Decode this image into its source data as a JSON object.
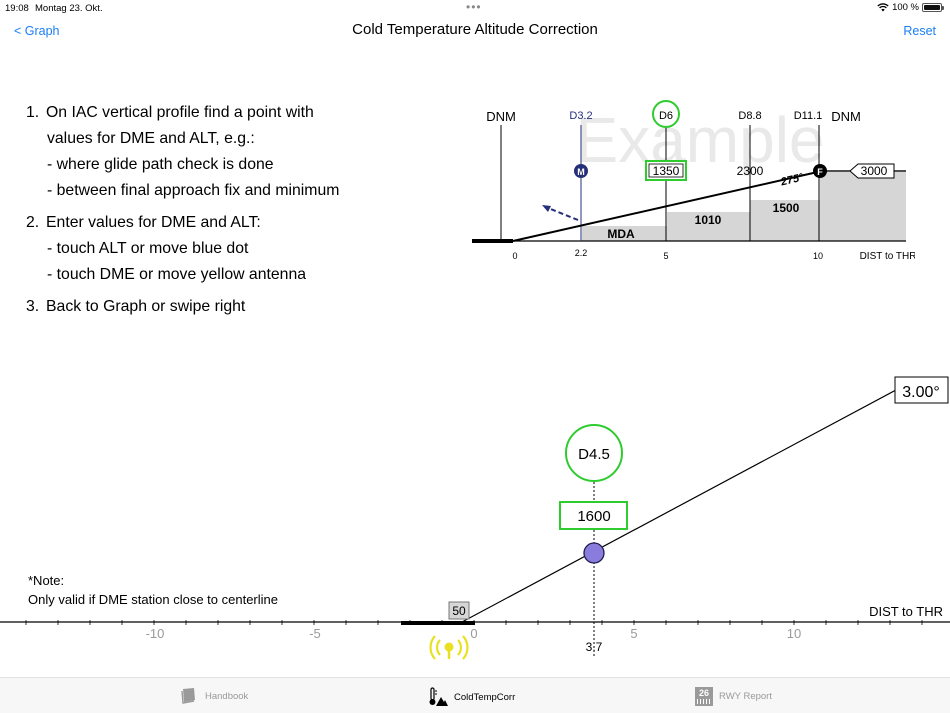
{
  "status": {
    "time": "19:08",
    "date": "Montag 23. Okt.",
    "battery": "100 %"
  },
  "nav": {
    "back": "< Graph",
    "title": "Cold Temperature Altitude Correction",
    "reset": "Reset"
  },
  "instructions": {
    "step1_num": "1.",
    "step1": "On IAC vertical profile find a point with",
    "step1_cont": "values for DME and ALT, e.g.:",
    "step1_a": "- where glide path check is done",
    "step1_b": "- between final approach fix and minimum",
    "step2_num": "2.",
    "step2": "Enter values for DME and ALT:",
    "step2_a": "- touch ALT or move blue dot",
    "step2_b": "- touch DME or move yellow antenna",
    "step3_num": "3.",
    "step3": "Back to Graph or swipe right"
  },
  "example": {
    "watermark": "Example",
    "dnm_left": "DNM",
    "d32": "D3.2",
    "d6": "D6",
    "d88": "D8.8",
    "d111": "D11.1",
    "dnm_right": "DNM",
    "m_marker": "M",
    "alt_1350": "1350",
    "alt_2300": "2300",
    "course": "275°",
    "f_marker": "F",
    "alt_3000": "3000",
    "alt_1010": "1010",
    "alt_1500": "1500",
    "mda": "MDA",
    "tick_0": "0",
    "tick_22": "2.2",
    "tick_5": "5",
    "tick_10": "10",
    "axis_label": "DIST to THR"
  },
  "graph": {
    "angle": "3.00°",
    "dme": "D4.5",
    "altitude": "1600",
    "threshold_height": "50",
    "axis_label": "DIST to THR",
    "dme_value": "3.7",
    "ticks": [
      "-10",
      "-5",
      "0",
      "5",
      "10"
    ]
  },
  "note": {
    "title": "*Note:",
    "text": "Only valid if DME station close to centerline"
  },
  "tabs": {
    "handbook": "Handbook",
    "coldtemp": "ColdTempCorr",
    "rwy_badge": "26",
    "rwy": "RWY Report"
  },
  "colors": {
    "accent": "#1a7ef5",
    "highlight_green": "#2ecc2e",
    "dot_purple": "#8a7cdc",
    "antenna_yellow": "#e8e020",
    "dme_navy": "#252f7a"
  }
}
